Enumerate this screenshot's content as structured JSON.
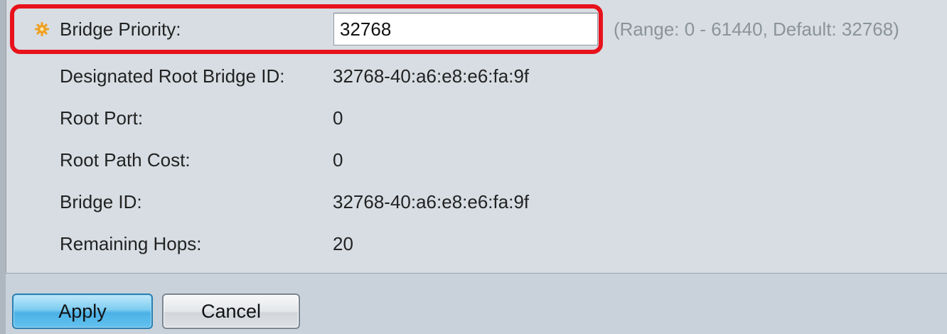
{
  "form": {
    "bridge_priority": {
      "label": "Bridge Priority:",
      "value": "32768",
      "range_note": "(Range: 0 - 61440, Default: 32768)",
      "required_icon": "gear-asterisk-icon"
    },
    "rows": [
      {
        "label": "Designated Root Bridge ID:",
        "value": "32768-40:a6:e8:e6:fa:9f"
      },
      {
        "label": "Root Port:",
        "value": "0"
      },
      {
        "label": "Root Path Cost:",
        "value": "0"
      },
      {
        "label": "Bridge ID:",
        "value": "32768-40:a6:e8:e6:fa:9f"
      },
      {
        "label": "Remaining Hops:",
        "value": "20"
      }
    ]
  },
  "buttons": {
    "apply_label": "Apply",
    "cancel_label": "Cancel"
  },
  "colors": {
    "highlight": "#e8121c",
    "required_icon": "#f0a020",
    "apply_button": "#4bb2e6"
  }
}
